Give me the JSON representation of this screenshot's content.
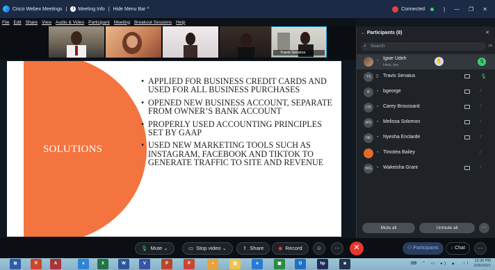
{
  "titlebar": {
    "app_name": "Cisco Webex Meetings",
    "sep1": "|",
    "meeting_info": "Meeting Info",
    "sep2": "|",
    "hide_menu": "Hide Menu Bar ^",
    "status": "Connected",
    "window_controls": [
      "|",
      "—",
      "❐",
      "✕"
    ]
  },
  "menubar": {
    "items": [
      "File",
      "Edit",
      "Share",
      "View",
      "Audio & Video",
      "Participant",
      "Meeting",
      "Breakout Sessions",
      "Help"
    ]
  },
  "video_strip": {
    "active_speaker_name": "Travis Senatus"
  },
  "slide": {
    "title": "SOLUTIONS",
    "bullets": [
      "APPLIED FOR BUSINESS CREDIT CARDS AND USED FOR ALL BUSINESS PURCHASES",
      "OPENED NEW BUSINESS ACCOUNT, SEPARATE FROM OWNER’S BANK ACCOUNT",
      "PROPERLY USED ACCOUNTING PRINCIPLES SET BY GAAP",
      "USED NEW MARKETING TOOLS SUCH AS INSTAGRAM, FACEBOOK AND TIKTOK TO GENERATE TRAFFIC TO SITE AND REVENUE"
    ],
    "accent_color": "#f4743f"
  },
  "participants": {
    "header": "Participants (8)",
    "close": "✕",
    "search_placeholder": "Search",
    "list": [
      {
        "name": "Igwe Udeh",
        "sub": "Host, me",
        "initials": ""
      },
      {
        "name": "Travis Senatus",
        "sub": "",
        "initials": "TS"
      },
      {
        "name": "bgeorge",
        "sub": "",
        "initials": "B"
      },
      {
        "name": "Carey Broussard",
        "sub": "",
        "initials": "CB"
      },
      {
        "name": "Melissa Solomon",
        "sub": "",
        "initials": "MS"
      },
      {
        "name": "Nyesha Enclarde",
        "sub": "",
        "initials": "NE"
      },
      {
        "name": "Timotea Bailey",
        "sub": "",
        "initials": ""
      },
      {
        "name": "Wakeisha Grant",
        "sub": "",
        "initials": "WG"
      }
    ],
    "mute_all": "Mute all",
    "unmute_all": "Unmute all",
    "more": "···"
  },
  "controls": {
    "mute": "Mute",
    "stop_video": "Stop video",
    "share": "Share",
    "record": "Record",
    "participants": "Participants",
    "chat": "Chat",
    "more": "···",
    "end": "✕"
  },
  "taskbar": {
    "time": "12:26 PM",
    "date": "2/26/2021"
  }
}
